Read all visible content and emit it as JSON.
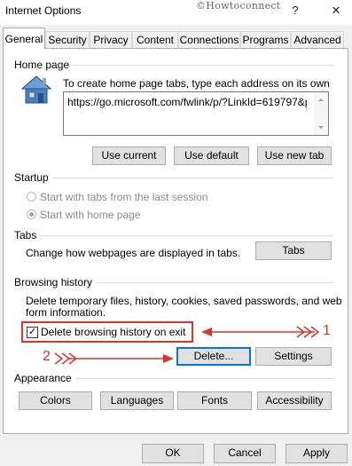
{
  "window": {
    "title": "Internet Options",
    "watermark": "©Howtoconnect",
    "help": "?",
    "close": "✕"
  },
  "tabs": [
    "General",
    "Security",
    "Privacy",
    "Content",
    "Connections",
    "Programs",
    "Advanced"
  ],
  "home_page": {
    "heading": "Home page",
    "instruction": "To create home page tabs, type each address on its own line.",
    "url": "https://go.microsoft.com/fwlink/p/?LinkId=619797&p",
    "buttons": [
      "Use current",
      "Use default",
      "Use new tab"
    ]
  },
  "startup": {
    "heading": "Startup",
    "options": [
      "Start with tabs from the last session",
      "Start with home page"
    ],
    "selected_index": 1
  },
  "tabs_section": {
    "heading": "Tabs",
    "text": "Change how webpages are displayed in tabs.",
    "button": "Tabs"
  },
  "browsing_history": {
    "heading": "Browsing history",
    "text_line1": "Delete temporary files, history, cookies, saved passwords, and web",
    "text_line2": "form information.",
    "checkbox_label": "Delete browsing history on exit",
    "checkbox_checked": true,
    "delete_button": "Delete...",
    "settings_button": "Settings"
  },
  "appearance": {
    "heading": "Appearance",
    "buttons": [
      "Colors",
      "Languages",
      "Fonts",
      "Accessibility"
    ]
  },
  "annotations": {
    "arrow1_label": "1",
    "arrow2_label": "2",
    "color": "#e0322b"
  },
  "footer": {
    "ok": "OK",
    "cancel": "Cancel",
    "apply": "Apply"
  }
}
